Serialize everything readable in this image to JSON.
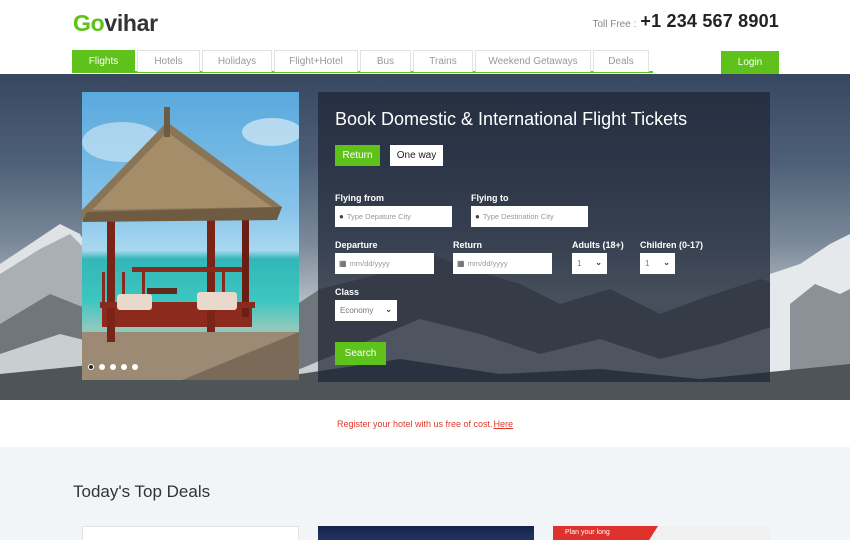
{
  "brand": {
    "logo_go": "Go",
    "logo_rest": "vihar"
  },
  "contact": {
    "label": "Toll Free :",
    "number": "+1 234 567 8901"
  },
  "nav": {
    "items": [
      {
        "label": "Flights",
        "active": true
      },
      {
        "label": "Hotels",
        "active": false
      },
      {
        "label": "Holidays",
        "active": false
      },
      {
        "label": "Flight+Hotel",
        "active": false
      },
      {
        "label": "Bus",
        "active": false
      },
      {
        "label": "Trains",
        "active": false
      },
      {
        "label": "Weekend Getaways",
        "active": false
      },
      {
        "label": "Deals",
        "active": false
      }
    ],
    "login_label": "Login"
  },
  "carousel": {
    "slides": 5,
    "active_index": 0
  },
  "booking": {
    "title": "Book Domestic & International Flight Tickets",
    "trip_return": "Return",
    "trip_oneway": "One way",
    "from_label": "Flying from",
    "from_placeholder": "Type Depature City",
    "to_label": "Flying to",
    "to_placeholder": "Type Destination City",
    "departure_label": "Departure",
    "departure_placeholder": "mm/dd/yyyy",
    "return_label": "Return",
    "return_placeholder": "mm/dd/yyyy",
    "adults_label": "Adults (18+)",
    "adults_value": "1",
    "children_label": "Children (0-17)",
    "children_value": "1",
    "class_label": "Class",
    "class_value": "Economy",
    "search_label": "Search"
  },
  "register": {
    "text": "Register your hotel with us free of cost.",
    "link": "Here"
  },
  "deals": {
    "title": "Today's Top Deals",
    "promo_text": "Plan your long"
  },
  "colors": {
    "accent": "#5fc21a",
    "link_red": "#e0382d",
    "panel": "rgba(30,37,52,0.72)"
  }
}
